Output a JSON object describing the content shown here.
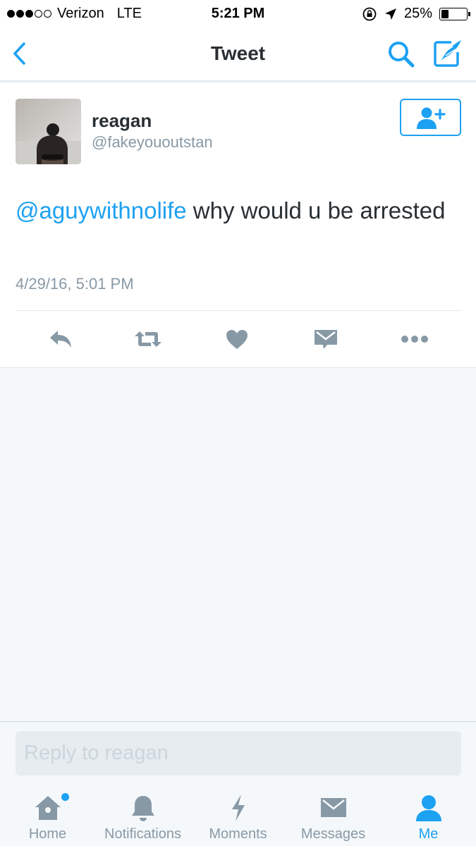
{
  "status_bar": {
    "carrier": "Verizon",
    "network": "LTE",
    "time": "5:21 PM",
    "battery": "25%",
    "battery_level": 0.25,
    "signal_bars": 3,
    "signal_total": 5
  },
  "nav": {
    "title": "Tweet",
    "back_icon": "chevron-left-icon",
    "search_icon": "search-icon",
    "compose_icon": "compose-icon"
  },
  "tweet": {
    "user_name": "reagan",
    "user_handle": "@fakeyououtstan",
    "mention": "@aguywithnolife",
    "text": " why would u be arrested",
    "timestamp": "4/29/16, 5:01 PM",
    "actions": [
      "reply-icon",
      "retweet-icon",
      "like-icon",
      "direct-message-icon",
      "more-icon"
    ]
  },
  "reply": {
    "placeholder": "Reply to reagan"
  },
  "tabs": [
    {
      "label": "Home",
      "icon": "home-icon",
      "has_badge": true
    },
    {
      "label": "Notifications",
      "icon": "bell-icon"
    },
    {
      "label": "Moments",
      "icon": "lightning-icon"
    },
    {
      "label": "Messages",
      "icon": "envelope-icon"
    },
    {
      "label": "Me",
      "icon": "person-icon",
      "active": true
    }
  ],
  "colors": {
    "accent": "#1da1f2",
    "text": "#292f33",
    "muted": "#8899a6",
    "icon_gray": "#8899a6",
    "background": "#f5f8fa"
  }
}
